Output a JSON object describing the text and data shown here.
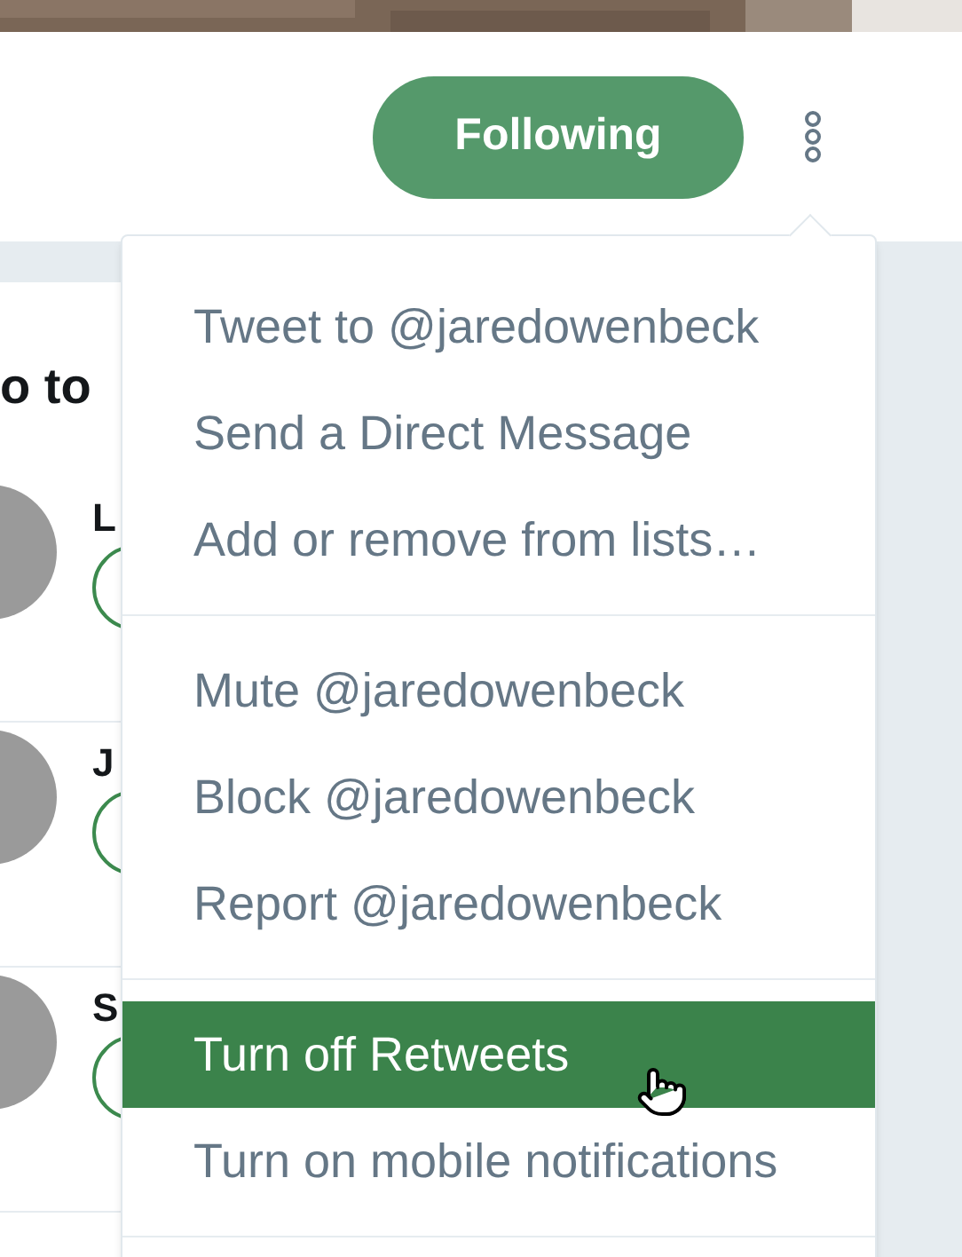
{
  "header": {
    "follow_button": "Following"
  },
  "sidebar": {
    "heading": "o to",
    "suggestions": [
      {
        "name": "L"
      },
      {
        "name": "J"
      },
      {
        "name": "S"
      }
    ]
  },
  "menu": {
    "groups": [
      [
        {
          "label": "Tweet to @jaredowenbeck",
          "selected": false
        },
        {
          "label": "Send a Direct Message",
          "selected": false
        },
        {
          "label": "Add or remove from lists…",
          "selected": false
        }
      ],
      [
        {
          "label": "Mute @jaredowenbeck",
          "selected": false
        },
        {
          "label": "Block @jaredowenbeck",
          "selected": false
        },
        {
          "label": "Report @jaredowenbeck",
          "selected": false
        }
      ],
      [
        {
          "label": "Turn off Retweets",
          "selected": true
        },
        {
          "label": "Turn on mobile notifications",
          "selected": false
        }
      ]
    ]
  }
}
